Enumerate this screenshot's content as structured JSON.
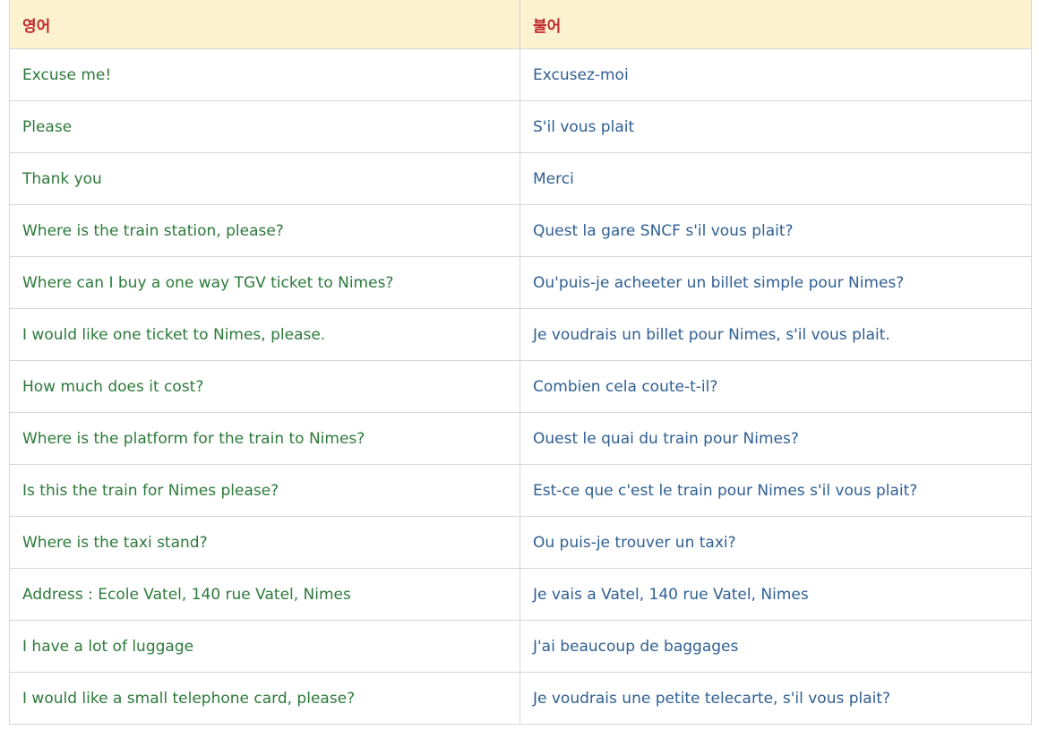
{
  "table": {
    "headers": {
      "english": "영어",
      "french": "불어"
    },
    "rows": [
      {
        "en": "Excuse me!",
        "fr": "Excusez-moi"
      },
      {
        "en": "Please",
        "fr": "S'il vous plait"
      },
      {
        "en": "Thank you",
        "fr": "Merci"
      },
      {
        "en": "Where is the train station, please?",
        "fr": "Quest la gare SNCF s'il vous plait?"
      },
      {
        "en": "Where can I buy a one way TGV ticket to Nimes?",
        "fr": "Ou'puis-je acheeter un billet simple pour Nimes?"
      },
      {
        "en": "I would like one ticket to Nimes, please.",
        "fr": "Je voudrais un billet pour Nimes, s'il vous plait."
      },
      {
        "en": "How much does it cost?",
        "fr": "Combien cela coute-t-il?"
      },
      {
        "en": "Where is the platform for the train to Nimes?",
        "fr": "Ouest le quai du train pour Nimes?"
      },
      {
        "en": "Is this the train for Nimes please?",
        "fr": "Est-ce que c'est le train pour Nimes s'il vous plait?"
      },
      {
        "en": "Where is the taxi stand?",
        "fr": "Ou puis-je trouver un taxi?"
      },
      {
        "en": "Address : Ecole Vatel, 140 rue Vatel, Nimes",
        "fr": "Je vais a Vatel, 140 rue Vatel, Nimes"
      },
      {
        "en": "I have a lot of luggage",
        "fr": "J'ai beaucoup de baggages"
      },
      {
        "en": "I would like a small telephone card, please?",
        "fr": "Je voudrais une petite telecarte, s'il vous plait?"
      }
    ]
  },
  "colors": {
    "header_bg": "#fcf2cf",
    "header_text": "#c0282a",
    "english_text": "#2c7a3a",
    "french_text": "#2f5f93",
    "border": "#d6d6d6"
  }
}
